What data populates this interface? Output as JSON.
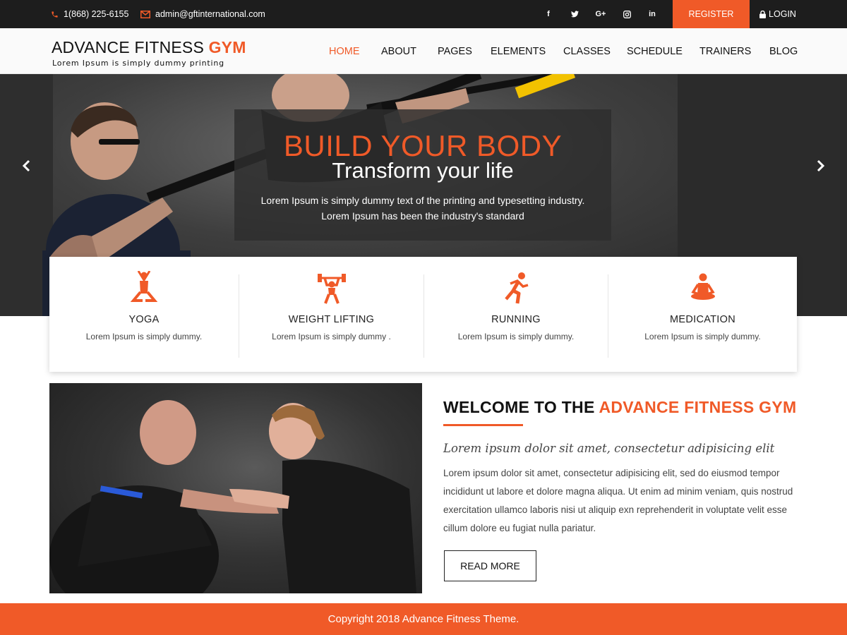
{
  "topbar": {
    "phone": "1(868) 225-6155",
    "email": "admin@gftinternational.com",
    "social": [
      "facebook-icon",
      "twitter-icon",
      "google-plus-icon",
      "instagram-icon",
      "linkedin-icon"
    ],
    "social_glyphs": [
      "f",
      "t",
      "G+",
      "ig",
      "in"
    ],
    "register_label": "REGISTER",
    "login_label": "LOGIN"
  },
  "header": {
    "brand_main": "ADVANCE FITNESS",
    "brand_accent": "GYM",
    "tagline": "Lorem Ipsum is simply dummy printing",
    "nav": [
      "HOME",
      "ABOUT",
      "PAGES",
      "ELEMENTS",
      "CLASSES",
      "SCHEDULE",
      "TRAINERS",
      "BLOG"
    ],
    "active_nav": "HOME"
  },
  "hero": {
    "title": "BUILD YOUR BODY",
    "subtitle": "Transform your life",
    "text_line1": "Lorem Ipsum is simply dummy text of the printing and typesetting industry.",
    "text_line2": "Lorem Ipsum has been the industry's standard"
  },
  "features": [
    {
      "icon": "yoga-icon",
      "title": "YOGA",
      "text": "Lorem Ipsum is simply dummy."
    },
    {
      "icon": "weight-lifting-icon",
      "title": "WEIGHT LIFTING",
      "text": "Lorem Ipsum is simply dummy ."
    },
    {
      "icon": "running-icon",
      "title": "RUNNING",
      "text": "Lorem Ipsum is simply dummy."
    },
    {
      "icon": "meditation-icon",
      "title": "MEDICATION",
      "text": "Lorem Ipsum is simply dummy."
    }
  ],
  "welcome": {
    "title_main": "WELCOME TO THE",
    "title_accent": "ADVANCE FITNESS GYM",
    "lead": "Lorem ipsum dolor sit amet, consectetur adipisicing elit",
    "body": "Lorem ipsum dolor sit amet, consectetur adipisicing elit, sed do eiusmod tempor incididunt ut labore et dolore magna aliqua. Ut enim ad minim veniam, quis nostrud exercitation ullamco laboris nisi ut aliquip exn reprehenderit in voluptate velit esse cillum dolore eu fugiat nulla pariatur.",
    "button_label": "READ MORE"
  },
  "footer": {
    "copyright": "Copyright 2018 Advance Fitness Theme."
  },
  "colors": {
    "accent": "#f05a28",
    "topbar_bg": "#1d1d1d",
    "footer_bg": "#f05a28"
  }
}
